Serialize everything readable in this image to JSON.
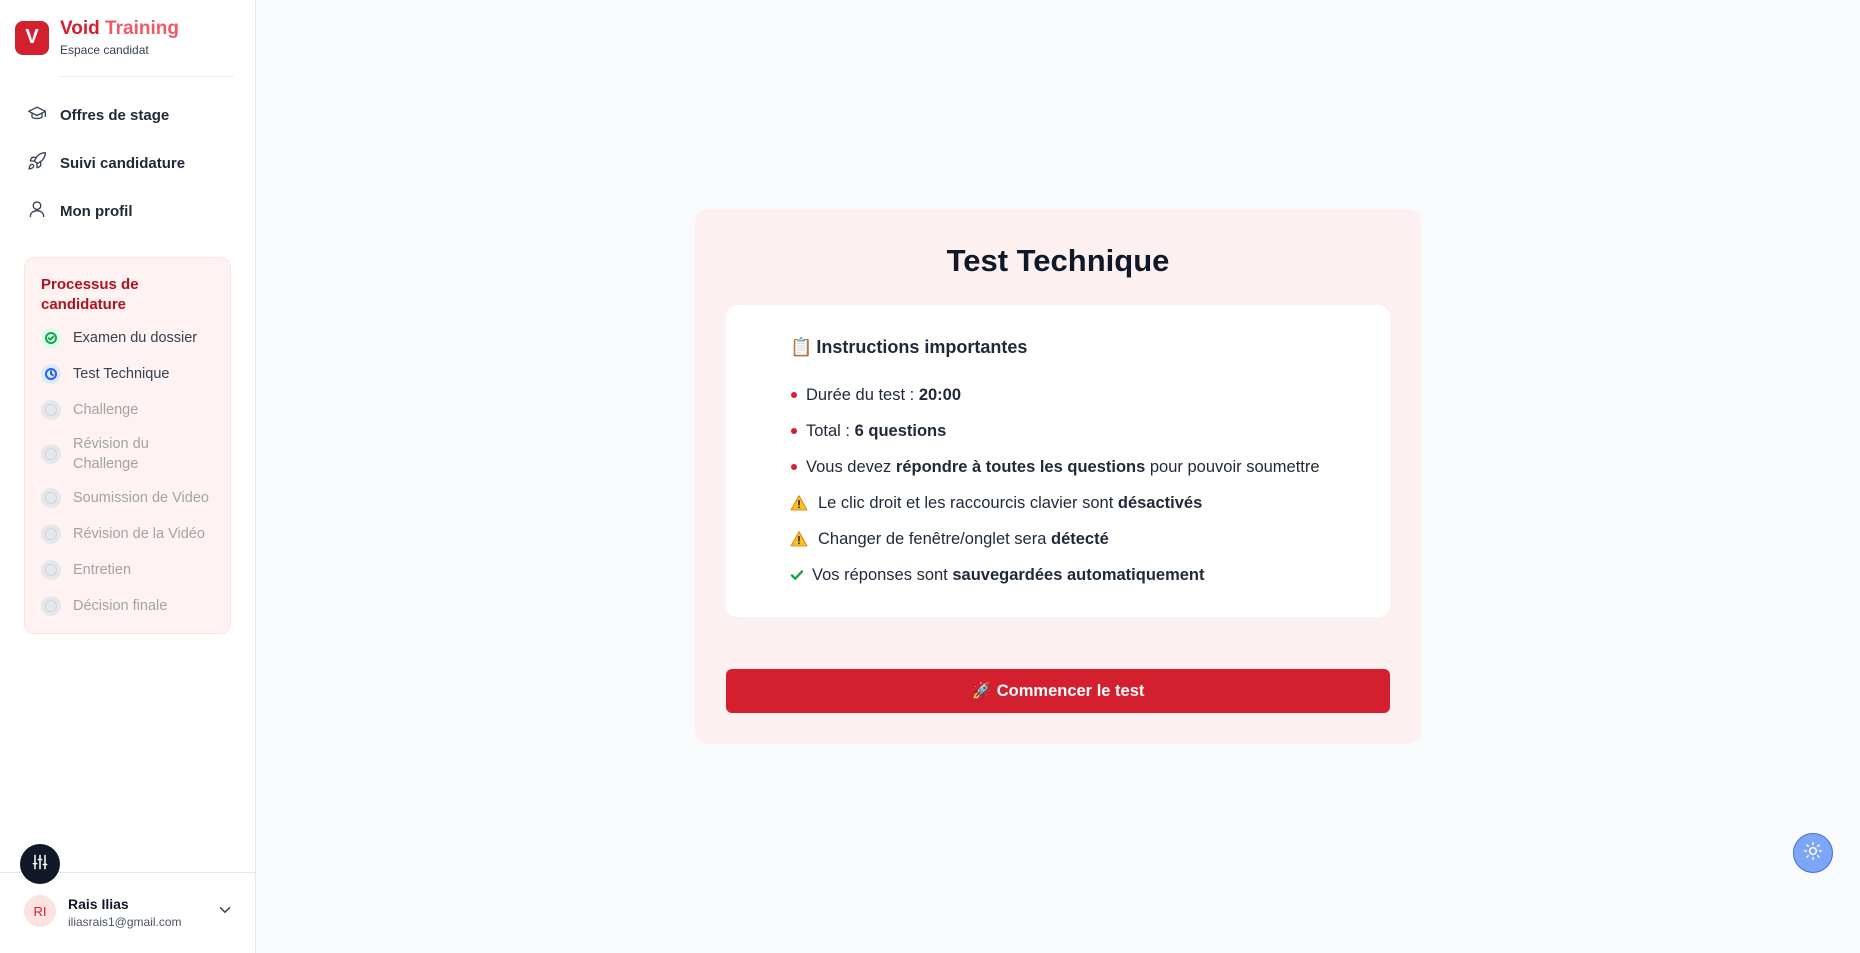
{
  "brand": {
    "logo_letter": "V",
    "title_part1": "Void",
    "title_part2": "Training",
    "subtitle": "Espace candidat"
  },
  "nav": {
    "items": [
      {
        "label": "Offres de stage",
        "icon": "graduation-cap-icon"
      },
      {
        "label": "Suivi candidature",
        "icon": "rocket-icon"
      },
      {
        "label": "Mon profil",
        "icon": "user-icon"
      }
    ]
  },
  "process": {
    "title": "Processus de candidature",
    "steps": [
      {
        "label": "Examen du dossier",
        "status": "done"
      },
      {
        "label": "Test Technique",
        "status": "current"
      },
      {
        "label": "Challenge",
        "status": "pending"
      },
      {
        "label": "Révision du Challenge",
        "status": "pending"
      },
      {
        "label": "Soumission de Video",
        "status": "pending"
      },
      {
        "label": "Révision de la Vidéo",
        "status": "pending"
      },
      {
        "label": "Entretien",
        "status": "pending"
      },
      {
        "label": "Décision finale",
        "status": "pending"
      }
    ]
  },
  "user": {
    "initials": "RI",
    "name": "Rais Ilias",
    "email": "iliasrais1@gmail.com"
  },
  "main": {
    "title": "Test Technique",
    "instructions": {
      "emoji": "📋",
      "title": "Instructions importantes",
      "rows": [
        {
          "icon": "bullet",
          "pre": "Durée du test : ",
          "bold": "20:00",
          "post": ""
        },
        {
          "icon": "bullet",
          "pre": "Total : ",
          "bold": "6 questions",
          "post": ""
        },
        {
          "icon": "bullet",
          "pre": "Vous devez ",
          "bold": "répondre à toutes les questions",
          "post": " pour pouvoir soumettre"
        },
        {
          "icon": "warning",
          "pre": "Le clic droit et les raccourcis clavier sont ",
          "bold": "désactivés",
          "post": ""
        },
        {
          "icon": "warning",
          "pre": "Changer de fenêtre/onglet sera ",
          "bold": "détecté",
          "post": ""
        },
        {
          "icon": "check",
          "pre": "Vos réponses sont ",
          "bold": "sauvegardées automatiquement",
          "post": ""
        }
      ]
    },
    "start_button": "🚀 Commencer le test"
  },
  "colors": {
    "accent": "#d41f2f",
    "accent_light": "#f05a66",
    "card_bg": "#fdf0f0",
    "done": "#16a34a",
    "current": "#2563eb"
  }
}
